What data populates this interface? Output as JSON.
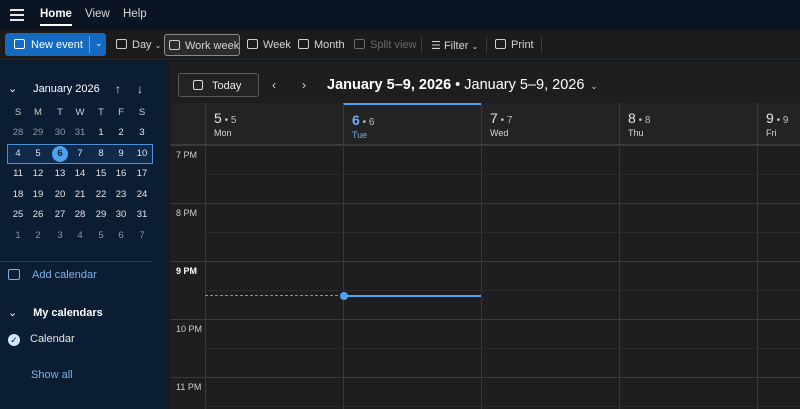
{
  "nav": {
    "tabs": [
      {
        "label": "Home",
        "active": true
      },
      {
        "label": "View",
        "active": false
      },
      {
        "label": "Help",
        "active": false
      }
    ]
  },
  "toolbar": {
    "new_event": "New event",
    "day": "Day",
    "work_week": "Work week",
    "week": "Week",
    "month": "Month",
    "split_view": "Split view",
    "filter": "Filter",
    "print": "Print"
  },
  "mini_calendar": {
    "title": "January 2026",
    "weekdays": [
      "S",
      "M",
      "T",
      "W",
      "T",
      "F",
      "S"
    ],
    "weeks": [
      [
        "28",
        "29",
        "30",
        "31",
        "1",
        "2",
        "3"
      ],
      [
        "4",
        "5",
        "6",
        "7",
        "8",
        "9",
        "10"
      ],
      [
        "11",
        "12",
        "13",
        "14",
        "15",
        "16",
        "17"
      ],
      [
        "18",
        "19",
        "20",
        "21",
        "22",
        "23",
        "24"
      ],
      [
        "25",
        "26",
        "27",
        "28",
        "29",
        "30",
        "31"
      ],
      [
        "1",
        "2",
        "3",
        "4",
        "5",
        "6",
        "7"
      ]
    ],
    "today": "6"
  },
  "sidebar": {
    "add_calendar": "Add calendar",
    "my_calendars": "My calendars",
    "calendar_item": "Calendar",
    "show_all": "Show all"
  },
  "main": {
    "today_label": "Today",
    "date_range_bold": "January 5–9, 2026",
    "date_range_rest": " • January 5–9, 2026",
    "days": [
      {
        "num": "5",
        "sub": " • 5",
        "name": "Mon"
      },
      {
        "num": "6",
        "sub": " • 6",
        "name": "Tue",
        "selected": true
      },
      {
        "num": "7",
        "sub": " • 7",
        "name": "Wed"
      },
      {
        "num": "8",
        "sub": " • 8",
        "name": "Thu"
      },
      {
        "num": "9",
        "sub": " • 9",
        "name": "Fri"
      }
    ],
    "times": [
      "7 PM",
      "8 PM",
      "9 PM",
      "10 PM",
      "11 PM"
    ],
    "current_hour": "9 PM"
  },
  "colors": {
    "accent": "#4ea1ee",
    "primary_button": "#1469c0",
    "sidebar_bg": "#0b1d33",
    "grid_bg": "#1e1e1e"
  }
}
